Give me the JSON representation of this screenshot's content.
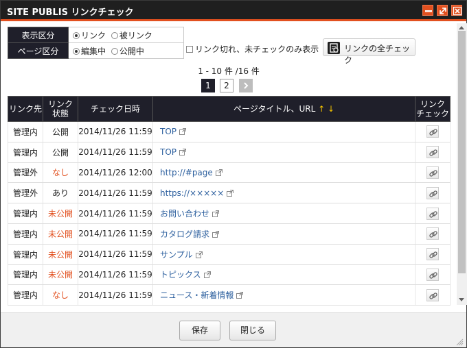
{
  "window": {
    "title": "SITE PUBLIS リンクチェック"
  },
  "filter": {
    "display_label": "表示区分",
    "display_options": [
      "リンク",
      "被リンク"
    ],
    "page_label": "ページ区分",
    "page_options": [
      "編集中",
      "公開中"
    ],
    "broken_only_label": "リンク切れ、未チェックのみ表示",
    "check_all_label": "リンクの全チェック"
  },
  "paging": {
    "count_text": "1 - 10 件 /16 件",
    "pages": [
      "1",
      "2"
    ],
    "current": "1"
  },
  "table": {
    "headers": {
      "dest": "リンク先",
      "status_l1": "リンク",
      "status_l2": "状態",
      "date": "チェック日時",
      "title": "ページタイトル、URL",
      "sort_up": "↑",
      "sort_down": "↓",
      "check_l1": "リンク",
      "check_l2": "チェック"
    },
    "rows": [
      {
        "dest": "管理内",
        "status": "公開",
        "status_red": false,
        "date": "2014/11/26 11:59",
        "title": "TOP"
      },
      {
        "dest": "管理内",
        "status": "公開",
        "status_red": false,
        "date": "2014/11/26 11:59",
        "title": "TOP"
      },
      {
        "dest": "管理外",
        "status": "なし",
        "status_red": true,
        "date": "2014/11/26 12:00",
        "title": "http://#page"
      },
      {
        "dest": "管理外",
        "status": "あり",
        "status_red": false,
        "date": "2014/11/26 11:59",
        "title": "https://×××××"
      },
      {
        "dest": "管理内",
        "status": "未公開",
        "status_red": true,
        "date": "2014/11/26 11:59",
        "title": "お問い合わせ"
      },
      {
        "dest": "管理内",
        "status": "未公開",
        "status_red": true,
        "date": "2014/11/26 11:59",
        "title": "カタログ請求"
      },
      {
        "dest": "管理内",
        "status": "未公開",
        "status_red": true,
        "date": "2014/11/26 11:59",
        "title": "サンプル"
      },
      {
        "dest": "管理内",
        "status": "未公開",
        "status_red": true,
        "date": "2014/11/26 11:59",
        "title": "トピックス"
      },
      {
        "dest": "管理内",
        "status": "なし",
        "status_red": true,
        "date": "2014/11/26 11:59",
        "title": "ニュース・新着情報"
      }
    ]
  },
  "footer": {
    "save_label": "保存",
    "close_label": "閉じる"
  }
}
